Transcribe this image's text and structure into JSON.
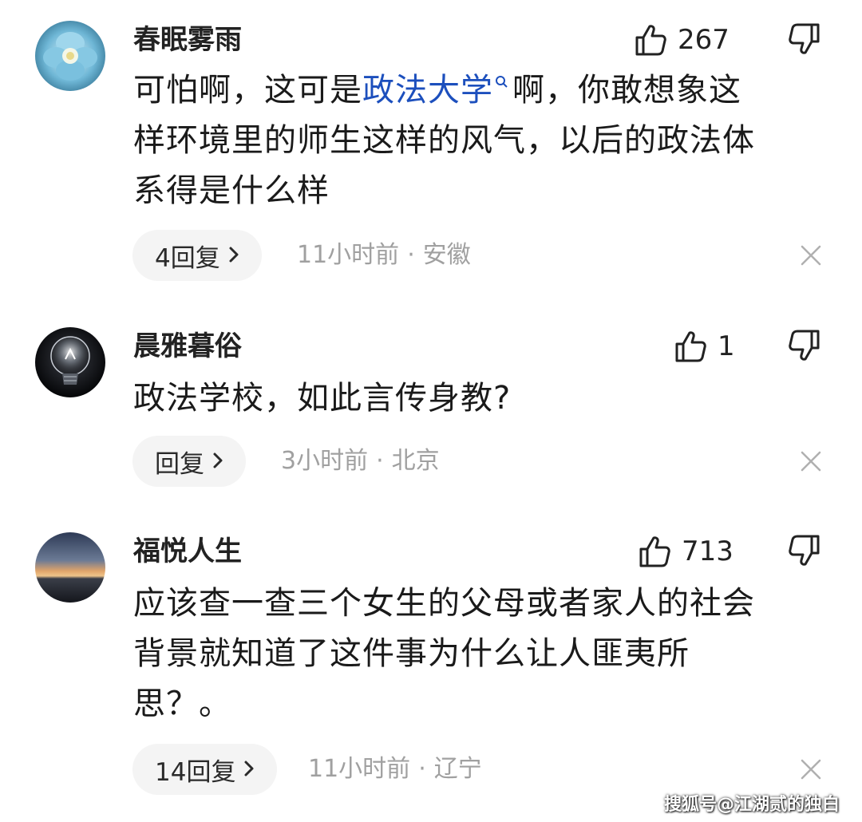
{
  "comments": [
    {
      "username": "春眠雾雨",
      "likes": "267",
      "content": {
        "line1_pre": "可怕啊，这可是",
        "line1_link": "政法大学",
        "line1_post": "啊，你敢想象这",
        "line2": "样环境里的师生这样的风气，以后的政法体",
        "line3": "系得是什么样"
      },
      "reply_label": "4回复",
      "time": "11小时前",
      "location": "安徽"
    },
    {
      "username": "晨雅暮俗",
      "likes": "1",
      "content": {
        "line1": "政法学校，如此言传身教?"
      },
      "reply_label": "回复",
      "time": "3小时前",
      "location": "北京"
    },
    {
      "username": "福悦人生",
      "likes": "713",
      "content": {
        "line1": "应该查一查三个女生的父母或者家人的社会",
        "line2": "背景就知道了这件事为什么让人匪夷所",
        "line3": "思？。"
      },
      "reply_label": "14回复",
      "time": "11小时前",
      "location": "辽宁"
    }
  ],
  "meta_separator": "·",
  "watermark": "搜狐号@江湖贰的独白",
  "colors": {
    "link": "#1c4fbd",
    "meta": "#a0a0a0",
    "pill_bg": "#f4f4f4"
  }
}
